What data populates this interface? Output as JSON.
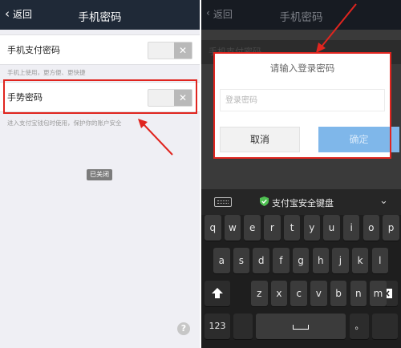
{
  "left": {
    "header": {
      "back_label": "返回",
      "back_chevron": "‹",
      "title": "手机密码",
      "bg": "#1f2937"
    },
    "rows": [
      {
        "label": "手机支付密码",
        "hint": "手机上使用，更方便、更快捷",
        "toggle": "off"
      },
      {
        "label": "手势密码",
        "hint": "进入支付宝钱包时使用，保护你的账户安全",
        "toggle": "off"
      }
    ],
    "toggle_x": "✕",
    "toast": "已关闭",
    "help_icon": "?"
  },
  "right": {
    "header": {
      "back_label": "返回",
      "back_chevron": "‹",
      "title": "手机密码"
    },
    "dim_row_label": "手机支付密码",
    "dialog": {
      "title": "请输入登录密码",
      "placeholder": "登录密码",
      "cancel_label": "取消",
      "ok_label": "确定"
    },
    "keyboard": {
      "title": "支付宝安全键盘",
      "shield_icon": "shield-check-icon",
      "rows": [
        [
          "q",
          "w",
          "e",
          "r",
          "t",
          "y",
          "u",
          "i",
          "o",
          "p"
        ],
        [
          "a",
          "s",
          "d",
          "f",
          "g",
          "h",
          "j",
          "k",
          "l"
        ],
        [
          "z",
          "x",
          "c",
          "v",
          "b",
          "n",
          "m"
        ]
      ],
      "num_label": "123",
      "period_label": "。"
    }
  },
  "colors": {
    "highlight": "#e0251f",
    "ok_button": "#7fb7ea",
    "shield": "#4fc152"
  }
}
